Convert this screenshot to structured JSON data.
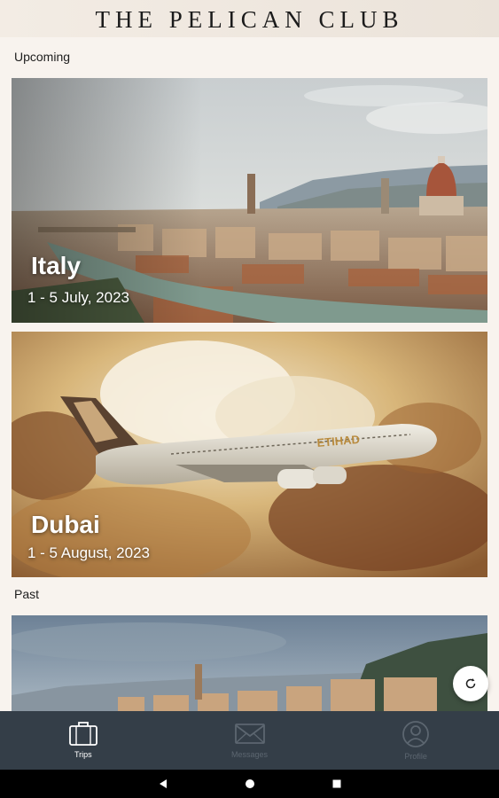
{
  "header": {
    "title": "THE PELICAN CLUB"
  },
  "sections": {
    "upcoming_label": "Upcoming",
    "past_label": "Past"
  },
  "trips": {
    "upcoming": [
      {
        "destination": "Italy",
        "dates": "1 - 5 July, 2023",
        "image": "florence-skyline-photo"
      },
      {
        "destination": "Dubai",
        "dates": "1 - 5 August, 2023",
        "image": "etihad-airplane-photo"
      }
    ],
    "past": [
      {
        "destination": "",
        "dates": "",
        "image": "coastal-hill-town-photo"
      }
    ]
  },
  "refresh": {
    "icon": "refresh-icon"
  },
  "nav": {
    "items": [
      {
        "label": "Trips",
        "icon": "suitcase-icon",
        "active": true
      },
      {
        "label": "Messages",
        "icon": "envelope-icon",
        "active": false
      },
      {
        "label": "Profile",
        "icon": "user-icon",
        "active": false
      }
    ]
  },
  "colors": {
    "background": "#f8f3ee",
    "nav_background": "#343e48",
    "nav_active": "#ffffff",
    "nav_inactive": "#5c6670"
  }
}
